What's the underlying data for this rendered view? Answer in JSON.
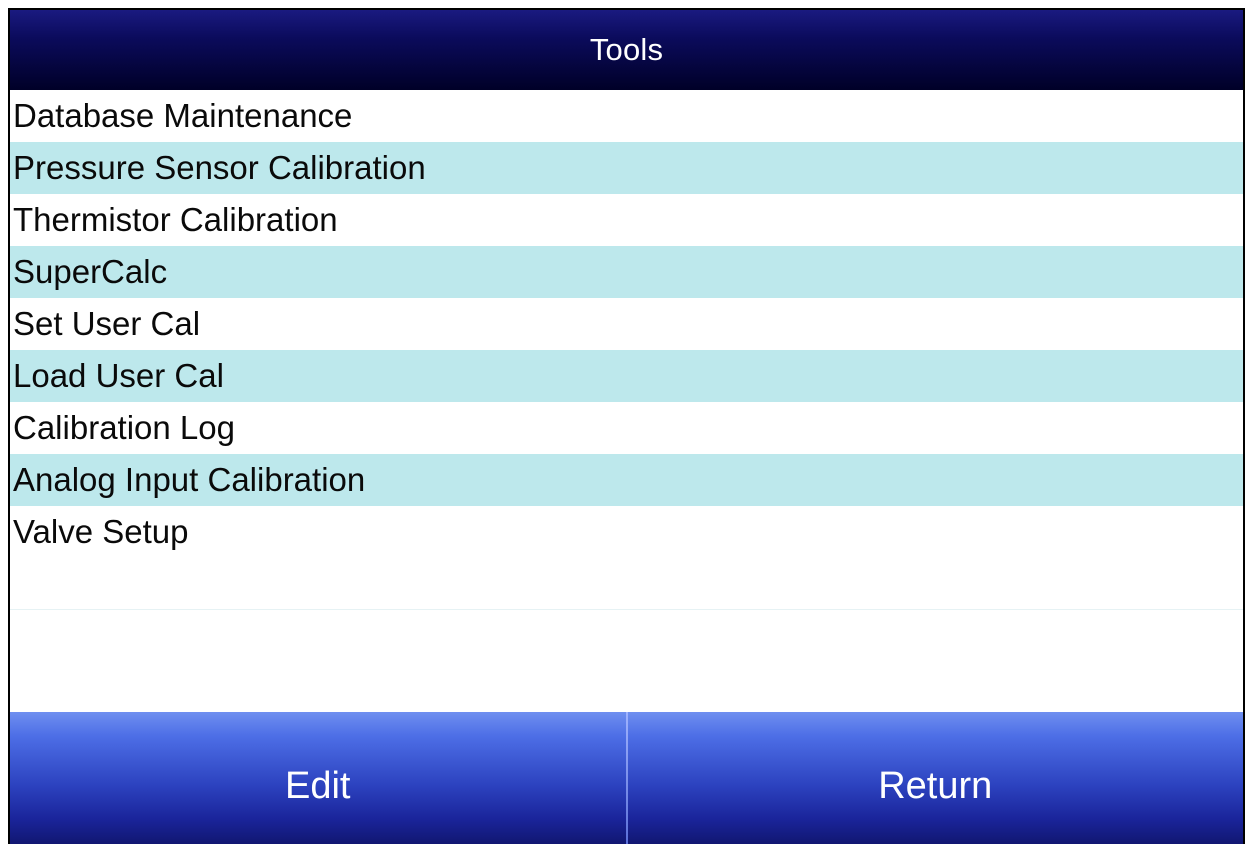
{
  "title": "Tools",
  "menu": {
    "items": [
      {
        "label": "Database Maintenance"
      },
      {
        "label": "Pressure Sensor Calibration"
      },
      {
        "label": "Thermistor Calibration"
      },
      {
        "label": "SuperCalc"
      },
      {
        "label": "Set User Cal"
      },
      {
        "label": "Load User Cal"
      },
      {
        "label": "Calibration Log"
      },
      {
        "label": "Analog Input Calibration"
      },
      {
        "label": "Valve Setup"
      }
    ]
  },
  "buttons": {
    "edit_label": "Edit",
    "return_label": "Return"
  },
  "colors": {
    "title_bar": "#05053f",
    "row_alternate": "#bde8ec",
    "button": "#2c42bf"
  }
}
